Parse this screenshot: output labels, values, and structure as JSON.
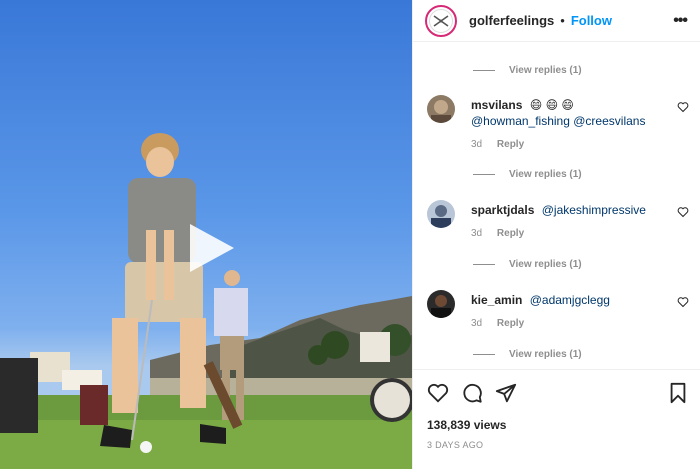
{
  "post": {
    "username": "golferfeelings",
    "separator": "•",
    "follow_label": "Follow",
    "more_icon": "more-horizontal-icon"
  },
  "comments": {
    "view_replies_label": "View replies (1)",
    "items": [
      {
        "username": "msvilans",
        "emoji": "😄 😄 😄",
        "mentions": [
          "@howman_fishing",
          "@creesvilans"
        ],
        "time": "3d",
        "reply_label": "Reply"
      },
      {
        "username": "sparktjdals",
        "mentions": [
          "@jakeshimpressive"
        ],
        "time": "3d",
        "reply_label": "Reply"
      },
      {
        "username": "kie_amin",
        "mentions": [
          "@adamjgclegg"
        ],
        "time": "3d",
        "reply_label": "Reply"
      }
    ]
  },
  "footer": {
    "views": "138,839 views",
    "posted": "3 DAYS AGO"
  },
  "colors": {
    "accent": "#0095f6",
    "mention": "#00376b",
    "muted": "#8e8e8e"
  }
}
